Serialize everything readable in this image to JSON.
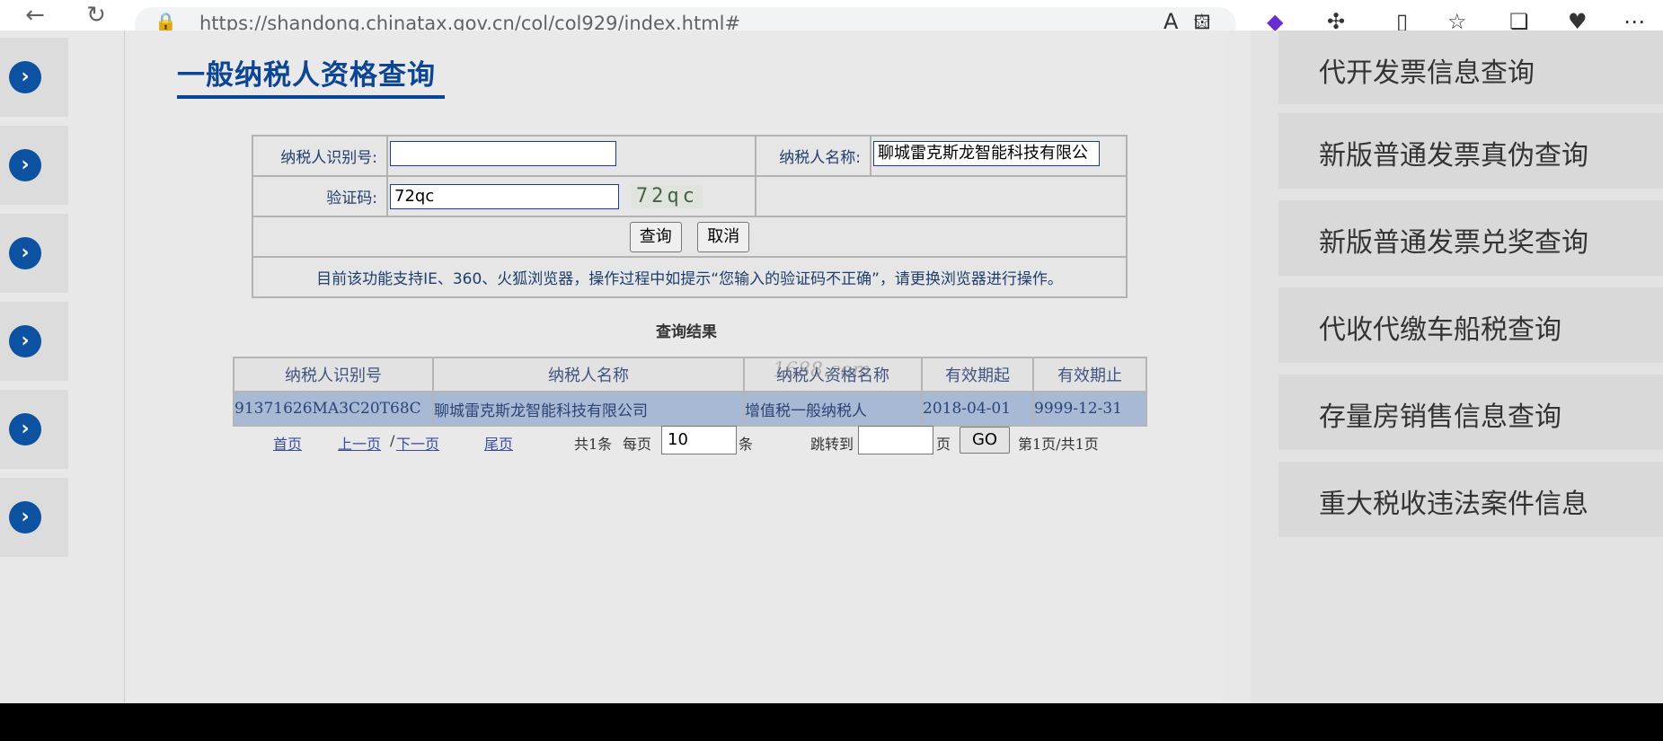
{
  "browser": {
    "url": "https://shandong.chinatax.gov.cn/col/col929/index.html#",
    "back_icon": "arrow-left",
    "reload_icon": "reload",
    "lock_icon": "lock",
    "read_aloud_icon": "read-aloud",
    "favorite_icon": "star",
    "extensions_icon": "puzzle",
    "split_icon": "split-screen",
    "favorites_icon": "favorites",
    "collections_icon": "collections",
    "health_icon": "heart",
    "menu_icon": "more"
  },
  "page": {
    "title": "一般纳税人资格查询"
  },
  "form": {
    "taxpayer_id_label": "纳税人识别号:",
    "taxpayer_id_value": "",
    "taxpayer_name_label": "纳税人名称:",
    "taxpayer_name_value": "聊城雷克斯龙智能科技有限公",
    "captcha_label": "验证码:",
    "captcha_value": "72qc",
    "captcha_image_text": "72qc",
    "query_button": "查询",
    "cancel_button": "取消",
    "notice": "目前该功能支持IE、360、火狐浏览器，操作过程中如提示“您输入的验证码不正确”，请更换浏览器进行操作。"
  },
  "results": {
    "title": "查询结果",
    "headers": [
      "纳税人识别号",
      "纳税人名称",
      "纳税人资格名称",
      "有效期起",
      "有效期止"
    ],
    "rows": [
      [
        "91371626MA3C20T68C",
        "聊城雷克斯龙智能科技有限公司",
        "增值税一般纳税人",
        "2018-04-01",
        "9999-12-31"
      ]
    ],
    "watermark": "1688.com"
  },
  "pager": {
    "first": "首页",
    "prev": "上一页",
    "sep": "/",
    "next": "下一页",
    "last": "尾页",
    "total": "共1条",
    "per_page_label": "每页",
    "per_page_value": "10",
    "per_page_unit": "条",
    "jump_label": "跳转到",
    "jump_value": "",
    "jump_unit": "页",
    "go_button": "GO",
    "page_info": "第1页/共1页"
  },
  "left_nav": {
    "items": [
      "arrow",
      "arrow",
      "arrow",
      "arrow",
      "arrow",
      "arrow"
    ]
  },
  "right_nav": {
    "items": [
      "代开发票信息查询",
      "新版普通发票真伪查询",
      "新版普通发票兑奖查询",
      "代收代缴车船税查询",
      "存量房销售信息查询",
      "重大税收违法案件信息"
    ]
  },
  "colors": {
    "brand_blue": "#0d4595",
    "result_row": "#a8b9d5"
  }
}
